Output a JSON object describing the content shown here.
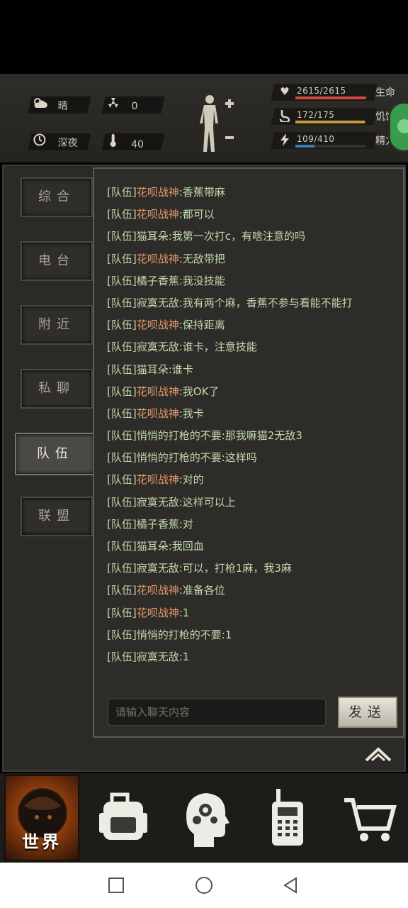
{
  "status": {
    "weather": "晴",
    "radiation": "0",
    "time_of_day": "深夜",
    "temperature": "40"
  },
  "vitals": {
    "health": {
      "value": "2615/2615",
      "label": "生命",
      "fill": 1.0,
      "color": "#d2473c"
    },
    "hunger": {
      "value": "172/175",
      "label": "饥饿",
      "fill": 0.98,
      "color": "#c89a3c"
    },
    "energy": {
      "value": "109/410",
      "label": "精力",
      "fill": 0.27,
      "color": "#3f7fb8"
    }
  },
  "tabs": [
    {
      "label": "综合"
    },
    {
      "label": "电台"
    },
    {
      "label": "附近"
    },
    {
      "label": "私聊"
    },
    {
      "label": "队伍"
    },
    {
      "label": "联盟"
    }
  ],
  "chat": {
    "messages": [
      {
        "channel": "[队伍]",
        "sender": "花呗战神",
        "special": true,
        "text": ":香蕉带麻"
      },
      {
        "channel": "[队伍]",
        "sender": "花呗战神",
        "special": true,
        "text": ":都可以"
      },
      {
        "channel": "[队伍]",
        "sender": "猫耳朵",
        "special": false,
        "text": ":我第一次打c，有啥注意的吗"
      },
      {
        "channel": "[队伍]",
        "sender": "花呗战神",
        "special": true,
        "text": ":无敌带把"
      },
      {
        "channel": "[队伍]",
        "sender": "橘子香蕉",
        "special": false,
        "text": ":我没技能"
      },
      {
        "channel": "[队伍]",
        "sender": "寂寞无敌",
        "special": false,
        "text": ":我有两个麻，香蕉不参与看能不能打"
      },
      {
        "channel": "[队伍]",
        "sender": "花呗战神",
        "special": true,
        "text": ":保持距离"
      },
      {
        "channel": "[队伍]",
        "sender": "寂寞无敌",
        "special": false,
        "text": ":谁卡，注意技能"
      },
      {
        "channel": "[队伍]",
        "sender": "猫耳朵",
        "special": false,
        "text": ":谁卡"
      },
      {
        "channel": "[队伍]",
        "sender": "花呗战神",
        "special": true,
        "text": ":我OK了"
      },
      {
        "channel": "[队伍]",
        "sender": "花呗战神",
        "special": true,
        "text": ":我卡"
      },
      {
        "channel": "[队伍]",
        "sender": "悄悄的打枪的不要",
        "special": false,
        "text": ":那我嘛猫2无敌3"
      },
      {
        "channel": "[队伍]",
        "sender": "悄悄的打枪的不要",
        "special": false,
        "text": ":这样吗"
      },
      {
        "channel": "[队伍]",
        "sender": "花呗战神",
        "special": true,
        "text": ":对的"
      },
      {
        "channel": "[队伍]",
        "sender": "寂寞无敌",
        "special": false,
        "text": ":这样可以上"
      },
      {
        "channel": "[队伍]",
        "sender": "橘子香蕉",
        "special": false,
        "text": ":对"
      },
      {
        "channel": "[队伍]",
        "sender": "猫耳朵",
        "special": false,
        "text": ":我回血"
      },
      {
        "channel": "[队伍]",
        "sender": "寂寞无敌",
        "special": false,
        "text": ":可以，打枪1麻，我3麻"
      },
      {
        "channel": "[队伍]",
        "sender": "花呗战神",
        "special": true,
        "text": ":准备各位"
      },
      {
        "channel": "[队伍]",
        "sender": "花呗战神",
        "special": true,
        "text": ":1"
      },
      {
        "channel": "[队伍]",
        "sender": "悄悄的打枪的不要",
        "special": false,
        "text": ":1"
      },
      {
        "channel": "[队伍]",
        "sender": "寂寞无敌",
        "special": false,
        "text": ":1"
      }
    ],
    "input_placeholder": "请输入聊天内容",
    "send_label": "发送"
  },
  "bottom_nav": {
    "world_label": "世界"
  }
}
